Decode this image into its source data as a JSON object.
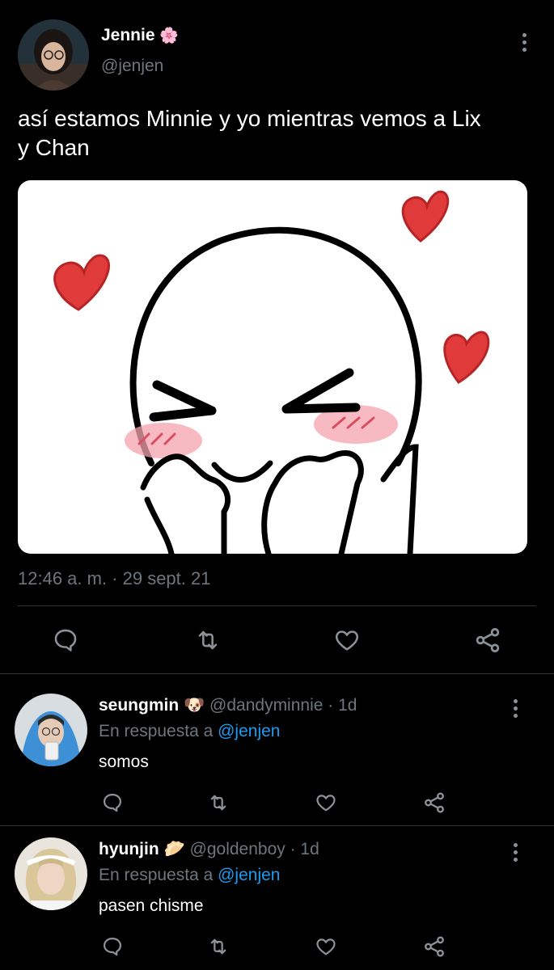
{
  "tweet": {
    "author_name": "Jennie",
    "author_emoji": "🌸",
    "author_handle": "@jenjen",
    "text_line1": "así estamos Minnie y yo mientras vemos a Lix",
    "text_line2": "y Chan",
    "timestamp": "12:46 a. m. · 29 sept. 21"
  },
  "replies": [
    {
      "name": "seungmin",
      "emoji": "🐶",
      "handle": "@dandyminnie · 1d",
      "reply_prefix": "En respuesta a",
      "reply_to": "@jenjen",
      "text": "somos"
    },
    {
      "name": "hyunjin",
      "emoji": "🥟",
      "handle": "@goldenboy · 1d",
      "reply_prefix": "En respuesta a",
      "reply_to": "@jenjen",
      "text": "pasen chisme"
    }
  ],
  "icons": [
    "reply-icon",
    "retweet-icon",
    "like-icon",
    "share-icon",
    "more-icon"
  ],
  "colors": {
    "background": "#000000",
    "link": "#1d9bf0",
    "muted": "#6e767d",
    "heart": "#e03a3a",
    "blush": "#f5a3ad"
  }
}
